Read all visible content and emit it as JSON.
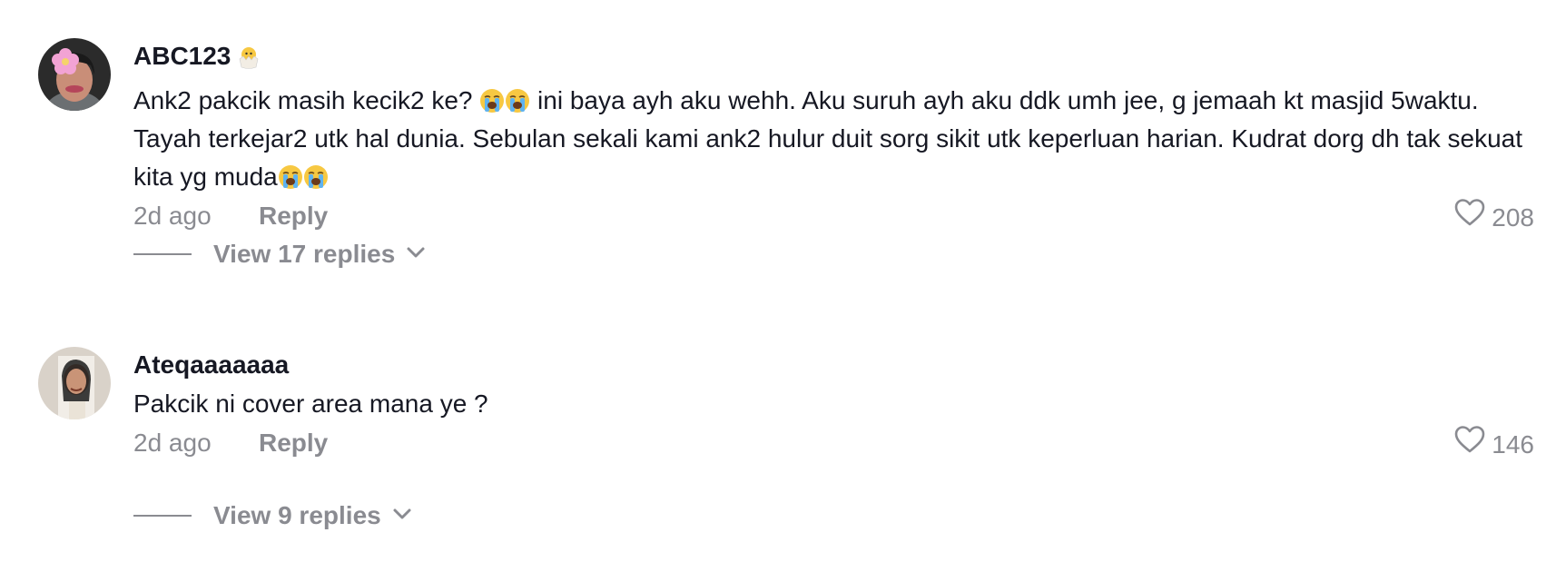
{
  "comments": [
    {
      "username": "ABC123",
      "badge_icon": "hatching-chick-icon",
      "text_parts": [
        "Ank2 pakcik masih kecik2 ke? ",
        " ini baya ayh aku wehh. Aku suruh ayh aku ddk umh jee, g jemaah kt masjid 5waktu. Tayah terkejar2 utk hal dunia. Sebulan sekali kami ank2 hulur duit sorg sikit utk keperluan harian. Kudrat dorg dh tak sekuat kita yg muda"
      ],
      "emoji_icon": "loudly-crying-face-icon",
      "time": "2d ago",
      "reply_label": "Reply",
      "likes": "208",
      "view_replies": "View 17 replies"
    },
    {
      "username": "Ateqaaaaaaa",
      "text": "Pakcik ni cover area mana ye ?",
      "time": "2d ago",
      "reply_label": "Reply",
      "likes": "146",
      "view_replies": "View 9 replies"
    }
  ],
  "colors": {
    "primary_text": "#161823",
    "secondary_text": "#8a8b91",
    "background": "#ffffff"
  }
}
